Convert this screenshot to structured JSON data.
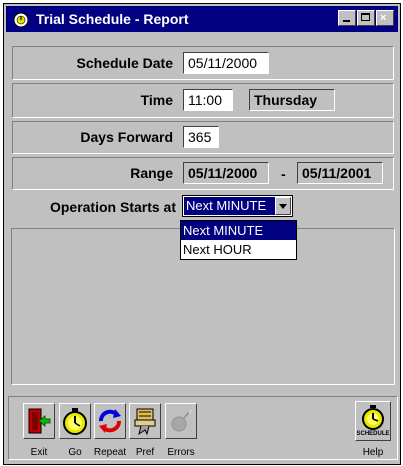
{
  "window": {
    "title": "Trial Schedule - Report"
  },
  "form": {
    "schedule_date": {
      "label": "Schedule Date",
      "value": "05/11/2000"
    },
    "time": {
      "label": "Time",
      "value": "11:00",
      "weekday": "Thursday"
    },
    "days_forward": {
      "label": "Days Forward",
      "value": "365"
    },
    "range": {
      "label": "Range",
      "start": "05/11/2000",
      "separator": "-",
      "end": "05/11/2001"
    },
    "operation_starts": {
      "label": "Operation Starts at",
      "selected": "Next MINUTE",
      "options": [
        "Next MINUTE",
        "Next HOUR"
      ]
    }
  },
  "toolbar": {
    "buttons": [
      {
        "label": "Exit",
        "icon": "exit-door-icon"
      },
      {
        "label": "Go",
        "icon": "stopwatch-icon"
      },
      {
        "label": "Repeat",
        "icon": "repeat-arrows-icon"
      },
      {
        "label": "Pref",
        "icon": "preferences-icon"
      },
      {
        "label": "Errors",
        "icon": "errors-icon"
      },
      {
        "label": "Help",
        "icon": "schedule-stopwatch-icon",
        "caption": "SCHEDULE"
      }
    ]
  }
}
